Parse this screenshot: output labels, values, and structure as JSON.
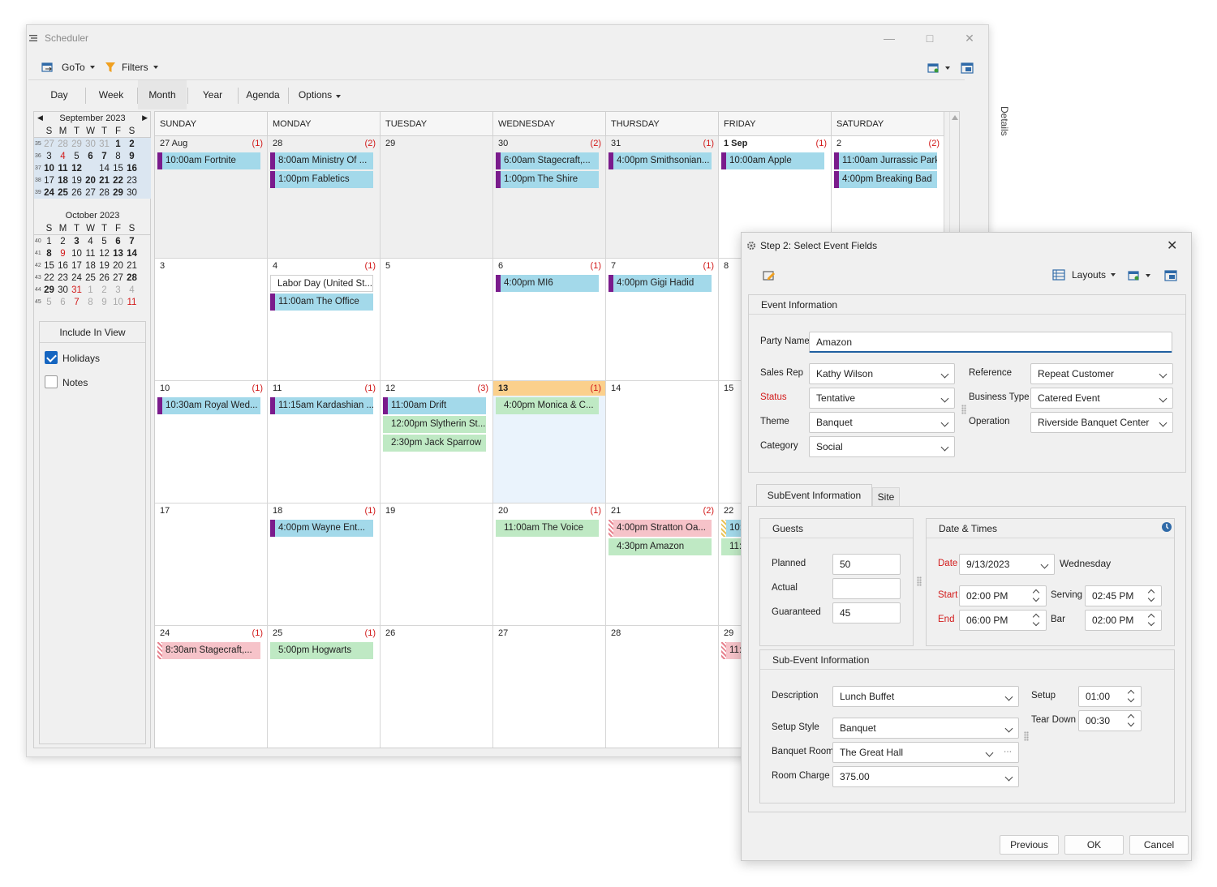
{
  "window": {
    "title": "Scheduler",
    "details_label": "Details"
  },
  "toolbar": {
    "goto_label": "GoTo",
    "filters_label": "Filters"
  },
  "views": {
    "day": "Day",
    "week": "Week",
    "month": "Month",
    "year": "Year",
    "agenda": "Agenda",
    "options": "Options",
    "selected": "Month"
  },
  "mini_calendars": [
    {
      "title": "September 2023",
      "dow": [
        "S",
        "M",
        "T",
        "W",
        "T",
        "F",
        "S"
      ],
      "weeks": [
        {
          "wk": "35",
          "days": [
            "27",
            "28",
            "29",
            "30",
            "31",
            "1",
            "2"
          ]
        },
        {
          "wk": "36",
          "days": [
            "3",
            "4",
            "5",
            "6",
            "7",
            "8",
            "9"
          ]
        },
        {
          "wk": "37",
          "days": [
            "10",
            "11",
            "12",
            "",
            "14",
            "15",
            "16"
          ]
        },
        {
          "wk": "38",
          "days": [
            "17",
            "18",
            "19",
            "20",
            "21",
            "22",
            "23"
          ]
        },
        {
          "wk": "39",
          "days": [
            "24",
            "25",
            "26",
            "27",
            "28",
            "29",
            "30"
          ]
        }
      ]
    },
    {
      "title": "October 2023",
      "dow": [
        "S",
        "M",
        "T",
        "W",
        "T",
        "F",
        "S"
      ],
      "weeks": [
        {
          "wk": "40",
          "days": [
            "1",
            "2",
            "3",
            "4",
            "5",
            "6",
            "7"
          ]
        },
        {
          "wk": "41",
          "days": [
            "8",
            "9",
            "10",
            "11",
            "12",
            "13",
            "14"
          ]
        },
        {
          "wk": "42",
          "days": [
            "15",
            "16",
            "17",
            "18",
            "19",
            "20",
            "21"
          ]
        },
        {
          "wk": "43",
          "days": [
            "22",
            "23",
            "24",
            "25",
            "26",
            "27",
            "28"
          ]
        },
        {
          "wk": "44",
          "days": [
            "29",
            "30",
            "31",
            "1",
            "2",
            "3",
            "4"
          ]
        },
        {
          "wk": "45",
          "days": [
            "5",
            "6",
            "7",
            "8",
            "9",
            "10",
            "11"
          ]
        }
      ]
    }
  ],
  "include_in_view": {
    "title": "Include In View",
    "holidays": "Holidays",
    "notes": "Notes"
  },
  "month": {
    "day_headers": [
      "SUNDAY",
      "MONDAY",
      "TUESDAY",
      "WEDNESDAY",
      "THURSDAY",
      "FRIDAY",
      "SATURDAY"
    ],
    "weeks": [
      [
        {
          "label": "27 Aug",
          "count": "(1)",
          "kind": "oth",
          "events": [
            {
              "text": "10:00am Fortnite",
              "color": "blue",
              "mark": "strip"
            }
          ]
        },
        {
          "label": "28",
          "count": "(2)",
          "kind": "oth",
          "events": [
            {
              "text": "8:00am Ministry Of ...",
              "color": "blue",
              "mark": "strip"
            },
            {
              "text": "1:00pm Fabletics",
              "color": "blue",
              "mark": "strip"
            }
          ]
        },
        {
          "label": "29",
          "count": "",
          "kind": "oth",
          "events": []
        },
        {
          "label": "30",
          "count": "(2)",
          "kind": "oth",
          "events": [
            {
              "text": "6:00am Stagecraft,...",
              "color": "blue",
              "mark": "strip"
            },
            {
              "text": "1:00pm The Shire",
              "color": "blue",
              "mark": "strip"
            }
          ]
        },
        {
          "label": "31",
          "count": "(1)",
          "kind": "oth",
          "events": [
            {
              "text": "4:00pm Smithsonian...",
              "color": "blue",
              "mark": "strip"
            }
          ]
        },
        {
          "label": "1 Sep",
          "count": "(1)",
          "kind": "cur",
          "bold": true,
          "events": [
            {
              "text": "10:00am Apple",
              "color": "blue",
              "mark": "strip"
            }
          ]
        },
        {
          "label": "2",
          "count": "(2)",
          "kind": "cur",
          "events": [
            {
              "text": "11:00am Jurrassic Park",
              "color": "blue",
              "mark": "strip"
            },
            {
              "text": "4:00pm Breaking Bad",
              "color": "blue",
              "mark": "strip"
            }
          ]
        }
      ],
      [
        {
          "label": "3",
          "count": "",
          "kind": "cur",
          "events": []
        },
        {
          "label": "4",
          "count": "(1)",
          "kind": "cur",
          "events": [
            {
              "text": "Labor Day (United St...",
              "color": "white",
              "mark": "none"
            },
            {
              "text": "11:00am The Office",
              "color": "blue",
              "mark": "strip"
            }
          ]
        },
        {
          "label": "5",
          "count": "",
          "kind": "cur",
          "events": []
        },
        {
          "label": "6",
          "count": "(1)",
          "kind": "cur",
          "events": [
            {
              "text": "4:00pm MI6",
              "color": "blue",
              "mark": "strip"
            }
          ]
        },
        {
          "label": "7",
          "count": "(1)",
          "kind": "cur",
          "events": [
            {
              "text": "4:00pm Gigi Hadid",
              "color": "blue",
              "mark": "strip"
            }
          ]
        },
        {
          "label": "8",
          "count": "",
          "kind": "cur",
          "events": []
        },
        {
          "label": "",
          "count": "",
          "kind": "cur",
          "events": []
        }
      ],
      [
        {
          "label": "10",
          "count": "(1)",
          "kind": "cur",
          "events": [
            {
              "text": "10:30am Royal Wed...",
              "color": "blue",
              "mark": "strip"
            }
          ]
        },
        {
          "label": "11",
          "count": "(1)",
          "kind": "cur",
          "events": [
            {
              "text": "11:15am Kardashian ...",
              "color": "blue",
              "mark": "strip"
            }
          ]
        },
        {
          "label": "12",
          "count": "(3)",
          "kind": "cur",
          "events": [
            {
              "text": "11:00am Drift",
              "color": "blue",
              "mark": "strip"
            },
            {
              "text": "12:00pm Slytherin St...",
              "color": "green",
              "mark": "none"
            },
            {
              "text": "2:30pm Jack Sparrow",
              "color": "green",
              "mark": "none"
            }
          ]
        },
        {
          "label": "13",
          "count": "(1)",
          "kind": "today",
          "bold": true,
          "events": [
            {
              "text": "4:00pm Monica & C...",
              "color": "green",
              "mark": "none"
            }
          ]
        },
        {
          "label": "14",
          "count": "",
          "kind": "cur",
          "events": []
        },
        {
          "label": "15",
          "count": "",
          "kind": "cur",
          "events": []
        },
        {
          "label": "",
          "count": "",
          "kind": "cur",
          "events": []
        }
      ],
      [
        {
          "label": "17",
          "count": "",
          "kind": "cur",
          "events": []
        },
        {
          "label": "18",
          "count": "(1)",
          "kind": "cur",
          "events": [
            {
              "text": "4:00pm Wayne Ent...",
              "color": "blue",
              "mark": "strip"
            }
          ]
        },
        {
          "label": "19",
          "count": "",
          "kind": "cur",
          "events": []
        },
        {
          "label": "20",
          "count": "(1)",
          "kind": "cur",
          "events": [
            {
              "text": "11:00am The Voice",
              "color": "green",
              "mark": "none"
            }
          ]
        },
        {
          "label": "21",
          "count": "(2)",
          "kind": "cur",
          "events": [
            {
              "text": "4:00pm Stratton Oa...",
              "color": "pink",
              "mark": "hatch"
            },
            {
              "text": "4:30pm Amazon",
              "color": "green",
              "mark": "none"
            }
          ]
        },
        {
          "label": "22",
          "count": "",
          "kind": "cur",
          "events": [
            {
              "text": "10:",
              "color": "blue",
              "mark": "hatchy"
            },
            {
              "text": "11:",
              "color": "green",
              "mark": "none"
            }
          ]
        },
        {
          "label": "",
          "count": "",
          "kind": "cur",
          "events": []
        }
      ],
      [
        {
          "label": "24",
          "count": "(1)",
          "kind": "cur",
          "events": [
            {
              "text": "8:30am Stagecraft,...",
              "color": "pink",
              "mark": "hatch"
            }
          ]
        },
        {
          "label": "25",
          "count": "(1)",
          "kind": "cur",
          "events": [
            {
              "text": "5:00pm Hogwarts",
              "color": "green",
              "mark": "none"
            }
          ]
        },
        {
          "label": "26",
          "count": "",
          "kind": "cur",
          "events": []
        },
        {
          "label": "27",
          "count": "",
          "kind": "cur",
          "events": []
        },
        {
          "label": "28",
          "count": "",
          "kind": "cur",
          "events": []
        },
        {
          "label": "29",
          "count": "",
          "kind": "cur",
          "events": [
            {
              "text": "11:",
              "color": "pink",
              "mark": "hatch"
            }
          ]
        },
        {
          "label": "",
          "count": "",
          "kind": "cur",
          "events": []
        }
      ]
    ]
  },
  "dialog": {
    "title": "Step 2:  Select Event Fields",
    "layouts_label": "Layouts",
    "event_info_title": "Event Information",
    "party_name": {
      "label": "Party Name",
      "value": "Amazon"
    },
    "sales_rep": {
      "label": "Sales Rep",
      "value": "Kathy Wilson"
    },
    "status": {
      "label": "Status",
      "value": "Tentative"
    },
    "theme": {
      "label": "Theme",
      "value": "Banquet"
    },
    "category": {
      "label": "Category",
      "value": "Social"
    },
    "reference": {
      "label": "Reference",
      "value": "Repeat Customer"
    },
    "business_type": {
      "label": "Business Type",
      "value": "Catered Event"
    },
    "operation": {
      "label": "Operation",
      "value": "Riverside Banquet Center"
    },
    "tabs": {
      "subevent": "SubEvent Information",
      "site": "Site"
    },
    "guests": {
      "title": "Guests",
      "planned_label": "Planned",
      "planned": "50",
      "actual_label": "Actual",
      "actual": "",
      "guaranteed_label": "Guaranteed",
      "guaranteed": "45"
    },
    "dates": {
      "title": "Date & Times",
      "date_label": "Date",
      "date": "9/13/2023",
      "weekday": "Wednesday",
      "start_label": "Start",
      "start": "02:00 PM",
      "end_label": "End",
      "end": "06:00 PM",
      "serving_label": "Serving",
      "serving": "02:45 PM",
      "bar_label": "Bar",
      "bar": "02:00 PM"
    },
    "sub": {
      "title": "Sub-Event Information",
      "description_label": "Description",
      "description": "Lunch Buffet",
      "setup_style_label": "Setup Style",
      "setup_style": "Banquet",
      "room_label": "Banquet Room",
      "room": "The Great Hall",
      "charge_label": "Room Charge",
      "charge": "375.00",
      "setup_label": "Setup",
      "setup": "01:00",
      "teardown_label": "Tear Down",
      "teardown": "00:30"
    },
    "buttons": {
      "previous": "Previous",
      "ok": "OK",
      "cancel": "Cancel"
    }
  }
}
